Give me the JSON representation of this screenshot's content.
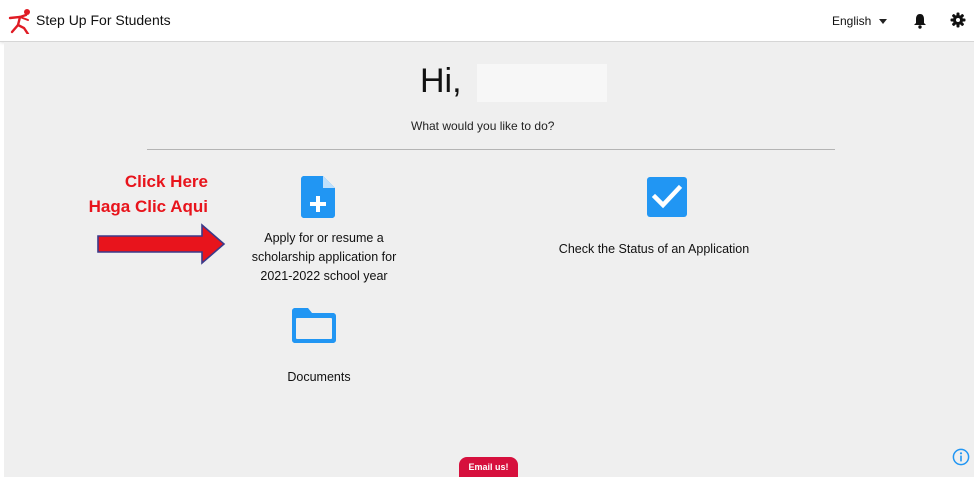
{
  "header": {
    "brand_name": "Step Up For Students",
    "language": "English",
    "icons": [
      "stepup-logo-icon",
      "chevron-down-icon",
      "bell-icon",
      "gear-icon"
    ]
  },
  "main": {
    "greeting": "Hi,",
    "prompt": "What would you like to do?",
    "annotation": {
      "line1": "Click Here",
      "line2": "Haga Clic Aqui",
      "color": "#e8141c"
    },
    "actions": [
      {
        "icon": "file-plus-icon",
        "label_lines": [
          "Apply for or resume a",
          "scholarship application for",
          "2021-2022 school year"
        ]
      },
      {
        "icon": "checkbox-icon",
        "label": "Check the Status of an Application"
      },
      {
        "icon": "folder-icon",
        "label": "Documents"
      }
    ]
  },
  "footer": {
    "email_label": "Email us!",
    "email_color": "#d6103d",
    "info_icon": "info-icon"
  },
  "colors": {
    "accent_blue": "#2196f3",
    "background": "#efefef",
    "header_bg": "#ffffff"
  }
}
